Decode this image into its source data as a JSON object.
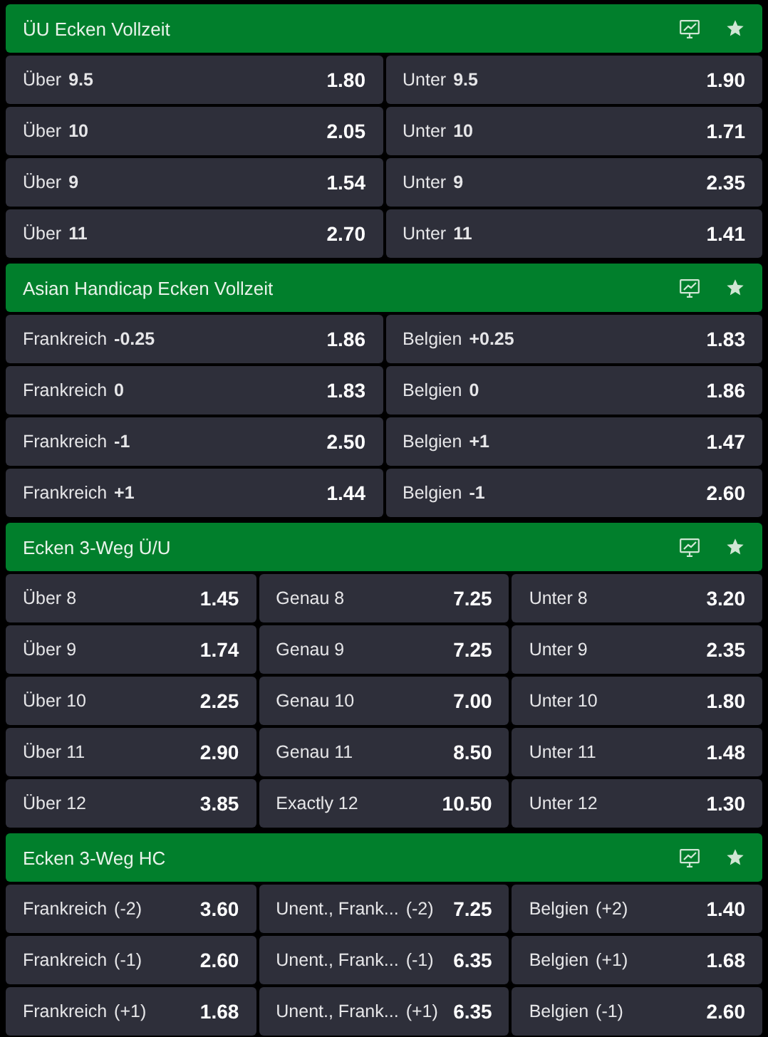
{
  "markets": [
    {
      "title": "ÜU Ecken Vollzeit",
      "kind": "two_way",
      "outcomes": [
        {
          "label": "Über",
          "line": "9.5",
          "odds": "1.80"
        },
        {
          "label": "Unter",
          "line": "9.5",
          "odds": "1.90"
        },
        {
          "label": "Über",
          "line": "10",
          "odds": "2.05"
        },
        {
          "label": "Unter",
          "line": "10",
          "odds": "1.71"
        },
        {
          "label": "Über",
          "line": "9",
          "odds": "1.54"
        },
        {
          "label": "Unter",
          "line": "9",
          "odds": "2.35"
        },
        {
          "label": "Über",
          "line": "11",
          "odds": "2.70"
        },
        {
          "label": "Unter",
          "line": "11",
          "odds": "1.41"
        }
      ]
    },
    {
      "title": "Asian Handicap Ecken Vollzeit",
      "kind": "two_way",
      "outcomes": [
        {
          "label": "Frankreich",
          "line": "-0.25",
          "odds": "1.86"
        },
        {
          "label": "Belgien",
          "line": "+0.25",
          "odds": "1.83"
        },
        {
          "label": "Frankreich",
          "line": "0",
          "odds": "1.83"
        },
        {
          "label": "Belgien",
          "line": "0",
          "odds": "1.86"
        },
        {
          "label": "Frankreich",
          "line": "-1",
          "odds": "2.50"
        },
        {
          "label": "Belgien",
          "line": "+1",
          "odds": "1.47"
        },
        {
          "label": "Frankreich",
          "line": "+1",
          "odds": "1.44"
        },
        {
          "label": "Belgien",
          "line": "-1",
          "odds": "2.60"
        }
      ]
    },
    {
      "title": "Ecken 3-Weg Ü/U",
      "kind": "three_way",
      "outcomes": [
        {
          "label": "Über 8",
          "odds": "1.45"
        },
        {
          "label": "Genau 8",
          "odds": "7.25"
        },
        {
          "label": "Unter 8",
          "odds": "3.20"
        },
        {
          "label": "Über 9",
          "odds": "1.74"
        },
        {
          "label": "Genau 9",
          "odds": "7.25"
        },
        {
          "label": "Unter 9",
          "odds": "2.35"
        },
        {
          "label": "Über 10",
          "odds": "2.25"
        },
        {
          "label": "Genau 10",
          "odds": "7.00"
        },
        {
          "label": "Unter 10",
          "odds": "1.80"
        },
        {
          "label": "Über 11",
          "odds": "2.90"
        },
        {
          "label": "Genau 11",
          "odds": "8.50"
        },
        {
          "label": "Unter 11",
          "odds": "1.48"
        },
        {
          "label": "Über 12",
          "odds": "3.85"
        },
        {
          "label": "Exactly 12",
          "odds": "10.50"
        },
        {
          "label": "Unter 12",
          "odds": "1.30"
        }
      ]
    },
    {
      "title": "Ecken 3-Weg HC",
      "kind": "three_way",
      "outcomes": [
        {
          "label": "Frankreich",
          "line": "(-2)",
          "odds": "3.60"
        },
        {
          "label": "Unent., Frank...",
          "line": "(-2)",
          "odds": "7.25"
        },
        {
          "label": "Belgien",
          "line": "(+2)",
          "odds": "1.40"
        },
        {
          "label": "Frankreich",
          "line": "(-1)",
          "odds": "2.60"
        },
        {
          "label": "Unent., Frank...",
          "line": "(-1)",
          "odds": "6.35"
        },
        {
          "label": "Belgien",
          "line": "(+1)",
          "odds": "1.68"
        },
        {
          "label": "Frankreich",
          "line": "(+1)",
          "odds": "1.68"
        },
        {
          "label": "Unent., Frank...",
          "line": "(+1)",
          "odds": "6.35"
        },
        {
          "label": "Belgien",
          "line": "(-1)",
          "odds": "2.60"
        }
      ]
    }
  ]
}
